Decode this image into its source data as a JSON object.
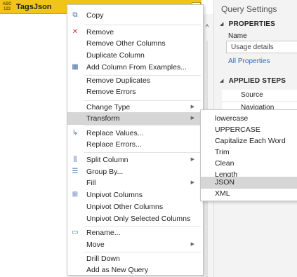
{
  "column": {
    "type_badge": "ABC 123",
    "title": "TagsJson",
    "dropdown_icon": "chevron-down"
  },
  "settings": {
    "title": "Query Settings",
    "properties_header": "PROPERTIES",
    "name_label": "Name",
    "name_value": "Usage details",
    "all_properties_link": "All Properties",
    "applied_steps_header": "APPLIED STEPS",
    "steps": [
      "Source",
      "Navigation"
    ]
  },
  "menu": {
    "items": [
      {
        "label": "Copy",
        "icon": "copy-icon"
      },
      {
        "label": "Remove",
        "icon": "remove-icon"
      },
      {
        "label": "Remove Other Columns"
      },
      {
        "label": "Duplicate Column"
      },
      {
        "label": "Add Column From Examples...",
        "icon": "table-icon"
      },
      {
        "label": "Remove Duplicates"
      },
      {
        "label": "Remove Errors"
      },
      {
        "label": "Change Type",
        "submenu": true
      },
      {
        "label": "Transform",
        "submenu": true,
        "active": true
      },
      {
        "label": "Replace Values...",
        "icon": "replace-icon"
      },
      {
        "label": "Replace Errors..."
      },
      {
        "label": "Split Column",
        "icon": "split-icon",
        "submenu": true
      },
      {
        "label": "Group By...",
        "icon": "group-icon"
      },
      {
        "label": "Fill",
        "submenu": true
      },
      {
        "label": "Unpivot Columns",
        "icon": "unpivot-icon"
      },
      {
        "label": "Unpivot Other Columns"
      },
      {
        "label": "Unpivot Only Selected Columns"
      },
      {
        "label": "Rename...",
        "icon": "rename-icon"
      },
      {
        "label": "Move",
        "submenu": true
      },
      {
        "label": "Drill Down"
      },
      {
        "label": "Add as New Query"
      }
    ]
  },
  "submenu": {
    "items": [
      {
        "label": "lowercase"
      },
      {
        "label": "UPPERCASE"
      },
      {
        "label": "Capitalize Each Word"
      },
      {
        "label": "Trim"
      },
      {
        "label": "Clean"
      },
      {
        "label": "Length"
      },
      {
        "label": "JSON",
        "active": true
      },
      {
        "label": "XML"
      }
    ]
  }
}
